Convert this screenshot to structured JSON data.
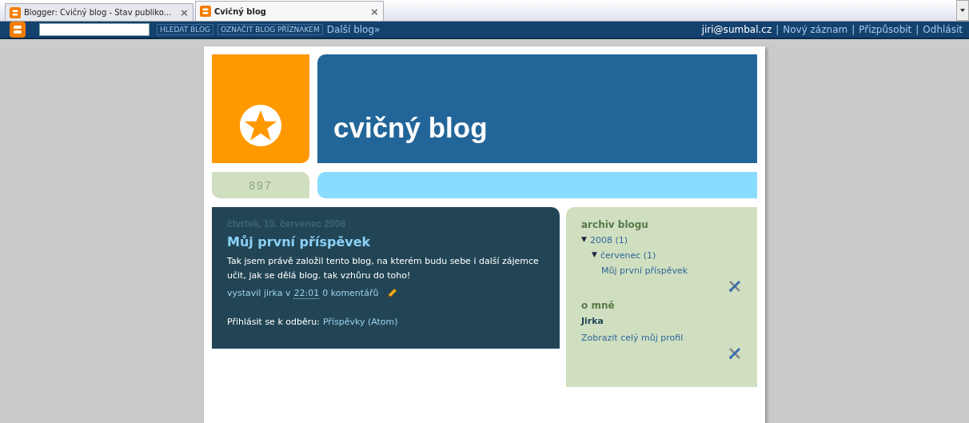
{
  "tabs": [
    {
      "label": "Blogger: Cvičný blog - Stav publiko...",
      "selected": false,
      "close": "×"
    },
    {
      "label": "Cvičný blog",
      "selected": true,
      "close": "×"
    }
  ],
  "navbar": {
    "buttons": [
      "HLEDAT BLOG",
      "OZNAČIT BLOG PŘÍZNAKEM"
    ],
    "next_blog": "Další blog»",
    "user": "jiri@sumbal.cz",
    "links": [
      "Nový záznam",
      "Přizpůsobit",
      "Odhlásit"
    ],
    "separator": "|"
  },
  "header": {
    "title": "cvičný blog",
    "badge": "897"
  },
  "post": {
    "date": "čtvrtek, 10. červenec 2008",
    "title": "Můj první příspěvek",
    "body": "Tak jsem právě založil tento blog, na kterém budu sebe i další zájemce učit, jak se dělá blog. tak vzhůru do toho!",
    "author": "vystavil jirka v",
    "time": "22:01",
    "comments": "0 komentářů",
    "subscribe_label": "Přihlásit se k odběru:",
    "subscribe_link": "Příspěvky (Atom)"
  },
  "sidebar": {
    "archive_title": "archiv blogu",
    "archive": [
      {
        "arrow": "▼",
        "label": "2008 (1)",
        "expanded": true,
        "children": [
          {
            "arrow": "▼",
            "label": "červenec (1)",
            "expanded": true,
            "children": [
              {
                "label": "Můj první příspěvek"
              }
            ]
          }
        ]
      }
    ],
    "about_title": "o mně",
    "name": "Jirka",
    "profile_link": "Zobrazit celý můj profil"
  }
}
